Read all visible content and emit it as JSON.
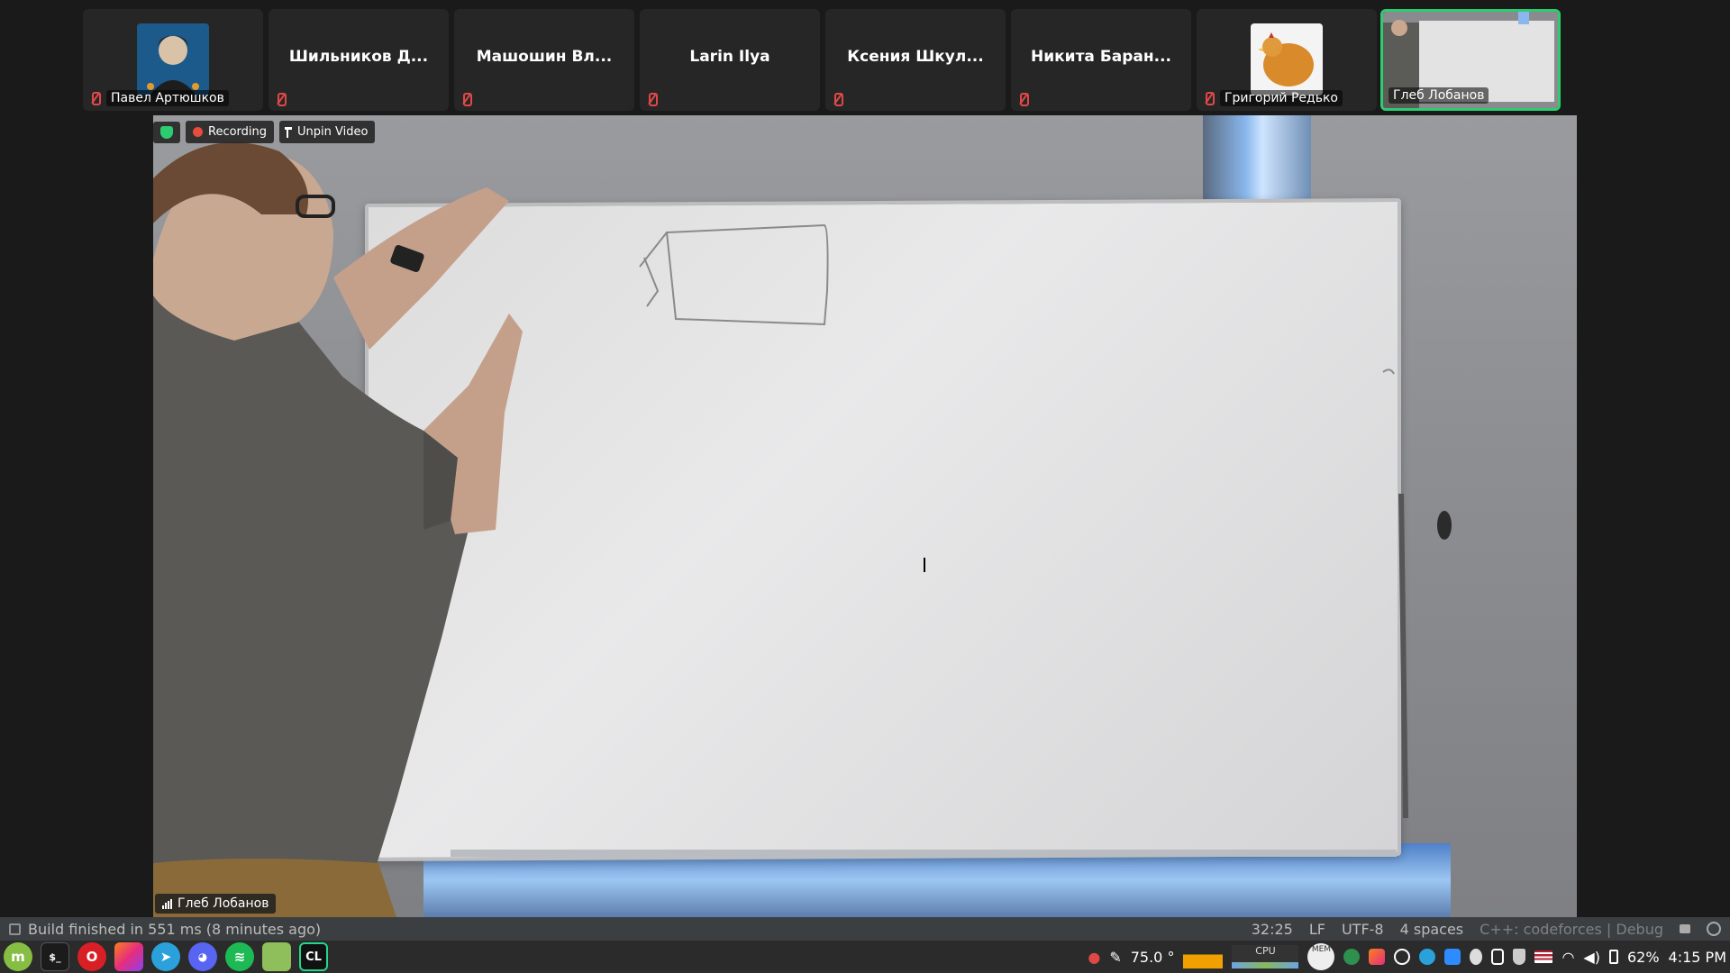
{
  "participants": [
    {
      "name": "Павел Артюшков",
      "has_avatar": true,
      "muted": true
    },
    {
      "name": "Шильников Д...",
      "muted": true
    },
    {
      "name": "Машошин Вл...",
      "muted": true
    },
    {
      "name": "Larin Ilya",
      "muted": true
    },
    {
      "name": "Ксения Шкул...",
      "muted": true
    },
    {
      "name": "Никита Баран...",
      "muted": true
    },
    {
      "name": "Григорий Редько",
      "has_avatar": true,
      "muted": true
    },
    {
      "name": "Глеб Лобанов",
      "active": true
    }
  ],
  "video": {
    "recording_label": "Recording",
    "unpin_label": "Unpin Video",
    "speaker_name": "Глеб Лобанов"
  },
  "ide_status": {
    "build_message": "Build finished in 551 ms (8 minutes ago)",
    "position": "32:25",
    "line_ending": "LF",
    "encoding": "UTF-8",
    "indent": "4 spaces",
    "context": "C++: codeforces | Debug"
  },
  "taskbar": {
    "apps": [
      "mint-menu",
      "terminal",
      "opera",
      "jetbrains-toolbox",
      "telegram",
      "discord",
      "spotify",
      "files",
      "clion"
    ],
    "temperature": "75.0 °",
    "cpu_label": "CPU",
    "mem_label": "MEM",
    "battery": "62%",
    "time": "4:15 PM"
  },
  "colors": {
    "active_border": "#2ecc71",
    "mute_red": "#e04848",
    "recording_red": "#e74c3c"
  }
}
